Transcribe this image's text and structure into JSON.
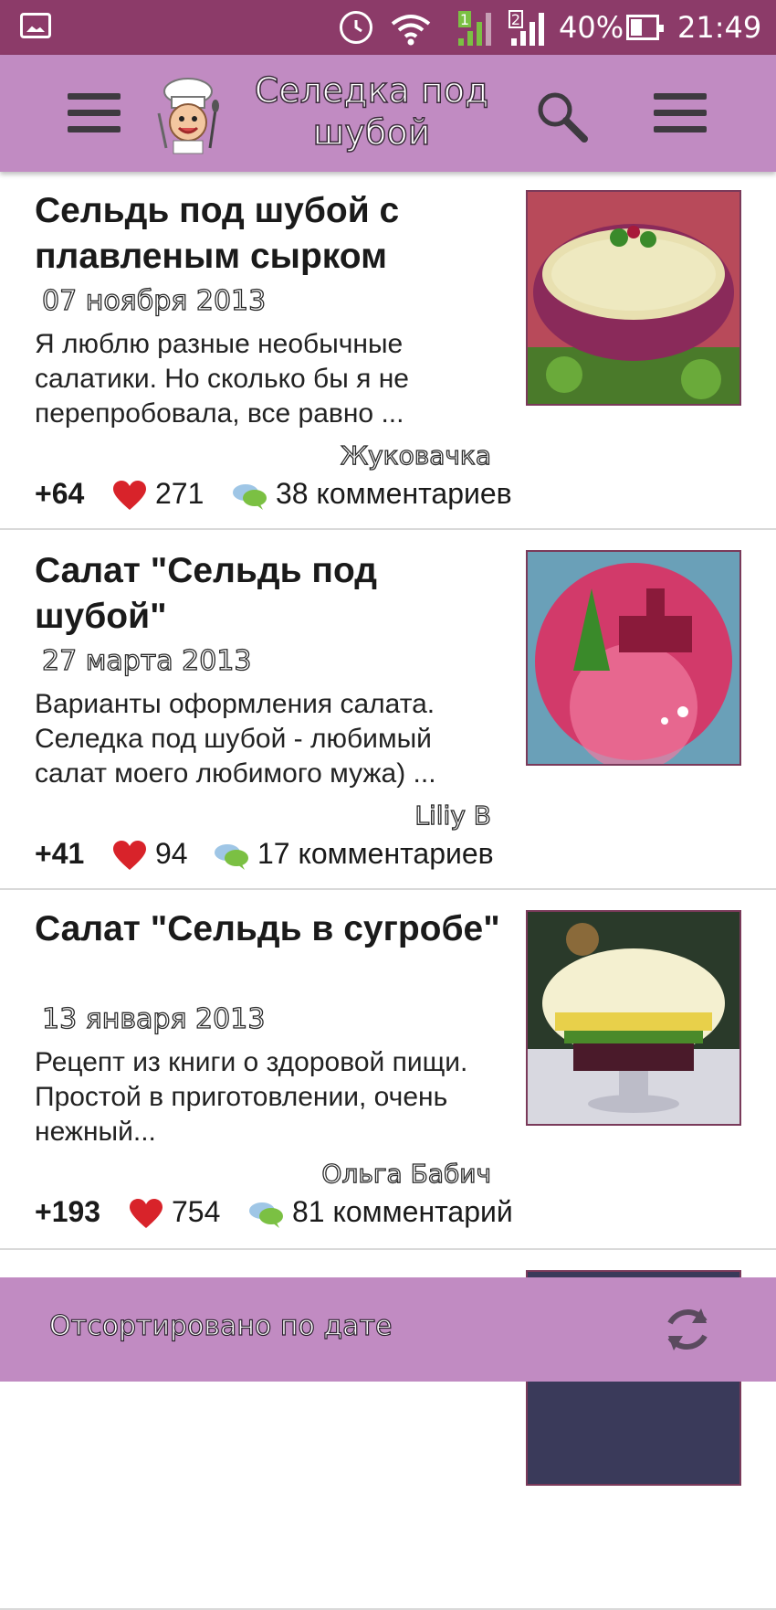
{
  "status_bar": {
    "battery": "40%",
    "time": "21:49",
    "sim1": "1",
    "sim2": "2"
  },
  "app_bar": {
    "title": "Селедка под шубой",
    "menu_icon": "hamburger-menu-icon",
    "logo": "chef-logo-icon",
    "search_icon": "search-icon",
    "overflow_icon": "hamburger-menu-icon"
  },
  "recipes": [
    {
      "title": "Сельдь под шубой с плавленым сырком",
      "date": "07 ноября 2013",
      "description": "Я люблю разные необычные салатики. Но сколько бы я не перепробовала, все равно ...",
      "author": "Жуковачка",
      "rating": "+64",
      "likes": "271",
      "comments": "38 комментариев"
    },
    {
      "title": "Салат \"Сельдь под шубой\"",
      "date": "27 марта 2013",
      "description": "Варианты оформления салата. Селедка под шубой - любимый салат моего любимого мужа) ...",
      "author": "Liliy B",
      "rating": "+41",
      "likes": "94",
      "comments": "17 комментариев"
    },
    {
      "title": "Салат \"Сельдь в сугробе\"",
      "date": "13 января 2013",
      "description": "Рецепт из книги о здоровой пищи. Простой в приготовлении, очень нежный...",
      "author": "Ольга Бабич",
      "rating": "+193",
      "likes": "754",
      "comments": "81 комментарий"
    }
  ],
  "bottom_bar": {
    "sort_label": "Отсортировано по дате",
    "refresh_icon": "refresh-icon"
  },
  "colors": {
    "status_bar": "#8c3b69",
    "app_bar": "#c18bc2",
    "heart": "#d8232a",
    "divider": "#d9d9d9"
  }
}
